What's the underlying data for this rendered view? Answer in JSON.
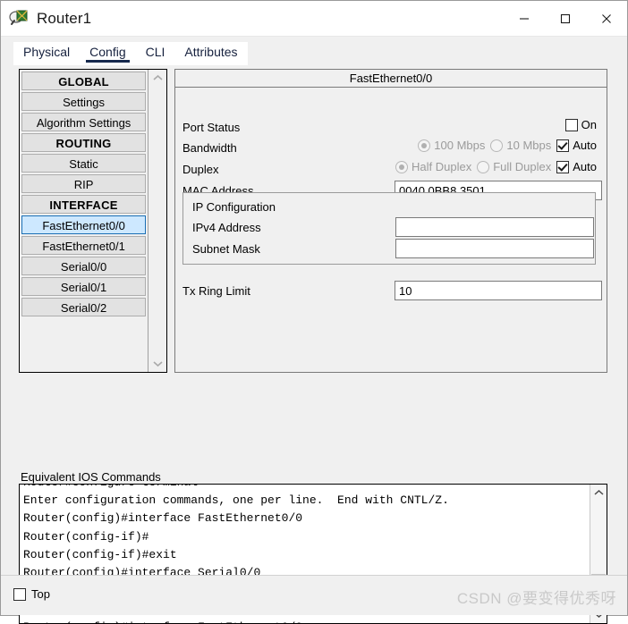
{
  "window": {
    "title": "Router1",
    "icon": "router-icon",
    "controls": {
      "minimize": "minimize-icon",
      "maximize": "maximize-icon",
      "close": "close-icon"
    }
  },
  "tabs": [
    {
      "label": "Physical",
      "active": false
    },
    {
      "label": "Config",
      "active": true
    },
    {
      "label": "CLI",
      "active": false
    },
    {
      "label": "Attributes",
      "active": false
    }
  ],
  "sidebar": {
    "items": [
      {
        "label": "GLOBAL",
        "type": "header"
      },
      {
        "label": "Settings",
        "type": "item"
      },
      {
        "label": "Algorithm Settings",
        "type": "item"
      },
      {
        "label": "ROUTING",
        "type": "header"
      },
      {
        "label": "Static",
        "type": "item"
      },
      {
        "label": "RIP",
        "type": "item"
      },
      {
        "label": "INTERFACE",
        "type": "header"
      },
      {
        "label": "FastEthernet0/0",
        "type": "item",
        "selected": true
      },
      {
        "label": "FastEthernet0/1",
        "type": "item"
      },
      {
        "label": "Serial0/0",
        "type": "item"
      },
      {
        "label": "Serial0/1",
        "type": "item"
      },
      {
        "label": "Serial0/2",
        "type": "item"
      }
    ]
  },
  "panel": {
    "title": "FastEthernet0/0",
    "port_status": {
      "label": "Port Status",
      "on_label": "On",
      "on_checked": false
    },
    "bandwidth": {
      "label": "Bandwidth",
      "opt_100": "100 Mbps",
      "opt_10": "10 Mbps",
      "auto_label": "Auto",
      "selected": "100 Mbps",
      "auto_checked": true
    },
    "duplex": {
      "label": "Duplex",
      "opt_half": "Half Duplex",
      "opt_full": "Full Duplex",
      "auto_label": "Auto",
      "selected": "Half Duplex",
      "auto_checked": true
    },
    "mac": {
      "label": "MAC Address",
      "value": "0040.0BB8.3501"
    },
    "ip_config": {
      "title": "IP Configuration",
      "ipv4_label": "IPv4 Address",
      "ipv4_value": "",
      "subnet_label": "Subnet Mask",
      "subnet_value": ""
    },
    "tx_ring": {
      "label": "Tx Ring Limit",
      "value": "10"
    }
  },
  "ios": {
    "label": "Equivalent IOS Commands",
    "lines": "Router#configure terminal\nEnter configuration commands, one per line.  End with CNTL/Z.\nRouter(config)#interface FastEthernet0/0\nRouter(config-if)#\nRouter(config-if)#exit\nRouter(config)#interface Serial0/0\nRouter(config-if)#\nRouter(config-if)#exit\nRouter(config)#interface FastEthernet0/0\nRouter(config-if)#"
  },
  "bottom": {
    "top_label": "Top",
    "top_checked": false,
    "watermark": "CSDN @要变得优秀呀"
  },
  "colors": {
    "accent": "#16294d",
    "selection": "#cde8ff",
    "selection_border": "#1a6fb5",
    "window_bg": "#f0f0f0"
  }
}
